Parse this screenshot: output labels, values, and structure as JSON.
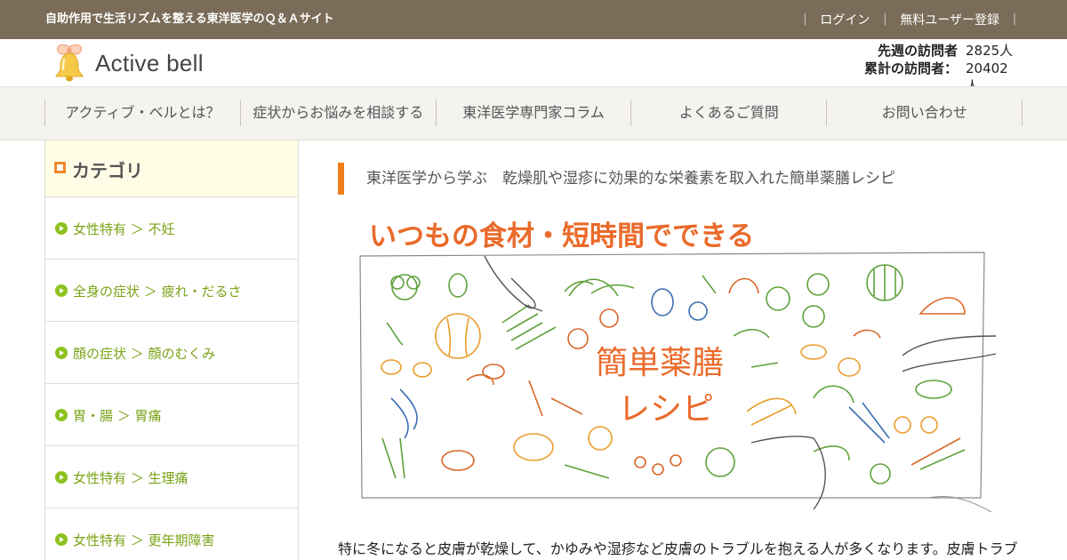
{
  "topbar": {
    "tagline": "自助作用で生活リズムを整える東洋医学のＱ＆Ａサイト",
    "login": "ログイン",
    "register": "無料ユーザー登録",
    "separator": "｜"
  },
  "header": {
    "logo_text": "Active bell",
    "logo_icon": "bell-icon",
    "visitors": [
      {
        "label": "先週の訪問者",
        "value": "2825人"
      },
      {
        "label": "累計の訪問者：",
        "value": "20402人"
      }
    ]
  },
  "nav": {
    "items": [
      "アクティブ・ベルとは？",
      "症状からお悩みを相談する",
      "東洋医学専門家コラム",
      "よくあるご質問",
      "お問い合わせ"
    ]
  },
  "sidebar": {
    "title": "カテゴリ",
    "items": [
      "女性特有 ＞ 不妊",
      "全身の症状 ＞ 疲れ・だるさ",
      "顔の症状 ＞ 顔のむくみ",
      "胃・腸 ＞ 胃痛",
      "女性特有 ＞ 生理痛",
      "女性特有 ＞ 更年期障害"
    ]
  },
  "main": {
    "title": "東洋医学から学ぶ　乾燥肌や湿疹に効果的な栄養素を取入れた簡単薬膳レシピ",
    "illustration": {
      "headline": "いつもの食材・短時間でできる",
      "center_line1": "簡単薬膳",
      "center_line2": "レシピ"
    },
    "body": "特に冬になると皮膚が乾燥して、かゆみや湿疹など皮膚のトラブルを抱える人が多くなります。皮膚トラブ"
  },
  "colors": {
    "topbar": "#7a6c58",
    "accent_orange": "#f07e1a",
    "sidebar_green": "#8cc21f",
    "sidebar_head_bg": "#fefde6",
    "nav_bg": "#f4f3f0"
  }
}
